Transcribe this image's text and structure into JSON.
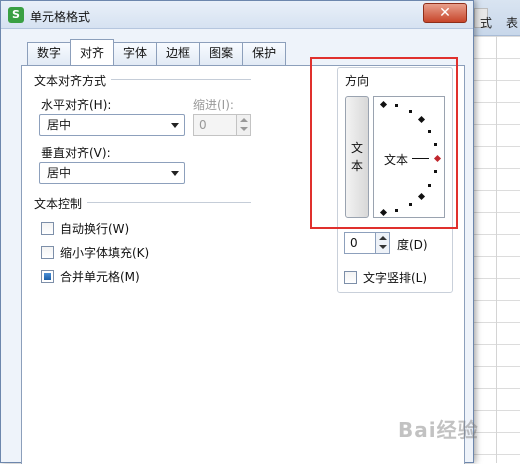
{
  "window": {
    "title": "单元格格式",
    "app_icon": "S",
    "close_glyph": "✕"
  },
  "background": {
    "right_labels": [
      "式",
      "表"
    ]
  },
  "tabs": [
    {
      "label": "数字"
    },
    {
      "label": "对齐"
    },
    {
      "label": "字体"
    },
    {
      "label": "边框"
    },
    {
      "label": "图案"
    },
    {
      "label": "保护"
    }
  ],
  "text_alignment": {
    "title": "文本对齐方式",
    "horizontal_label": "水平对齐(H):",
    "horizontal_value": "居中",
    "indent_label": "缩进(I):",
    "indent_value": "0",
    "vertical_label": "垂直对齐(V):",
    "vertical_value": "居中"
  },
  "text_control": {
    "title": "文本控制",
    "wrap_label": "自动换行(W)",
    "wrap_checked": false,
    "shrink_label": "缩小字体填充(K)",
    "shrink_checked": false,
    "merge_label": "合并单元格(M)",
    "merge_checked": true
  },
  "orientation": {
    "title": "方向",
    "vertical_text_chars": [
      "文",
      "本"
    ],
    "preview_text": "文本",
    "degree_value": "0",
    "degree_label": "度(D)",
    "vertical_stack_label": "文字竖排(L)",
    "vertical_stack_checked": false
  },
  "watermark": "Bai经验"
}
